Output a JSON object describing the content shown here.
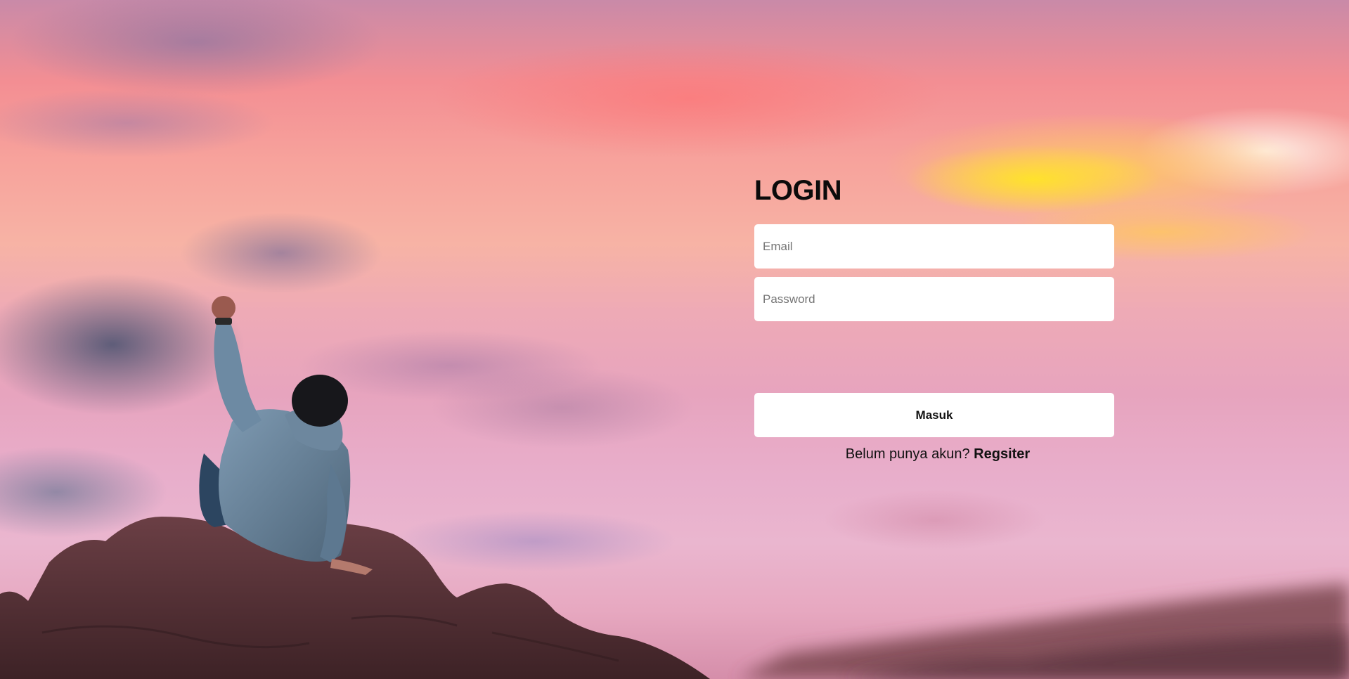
{
  "login": {
    "title": "LOGIN",
    "email_placeholder": "Email",
    "password_placeholder": "Password",
    "submit_label": "Masuk",
    "register_prompt": "Belum punya akun?",
    "register_link_label": "Regsiter"
  }
}
